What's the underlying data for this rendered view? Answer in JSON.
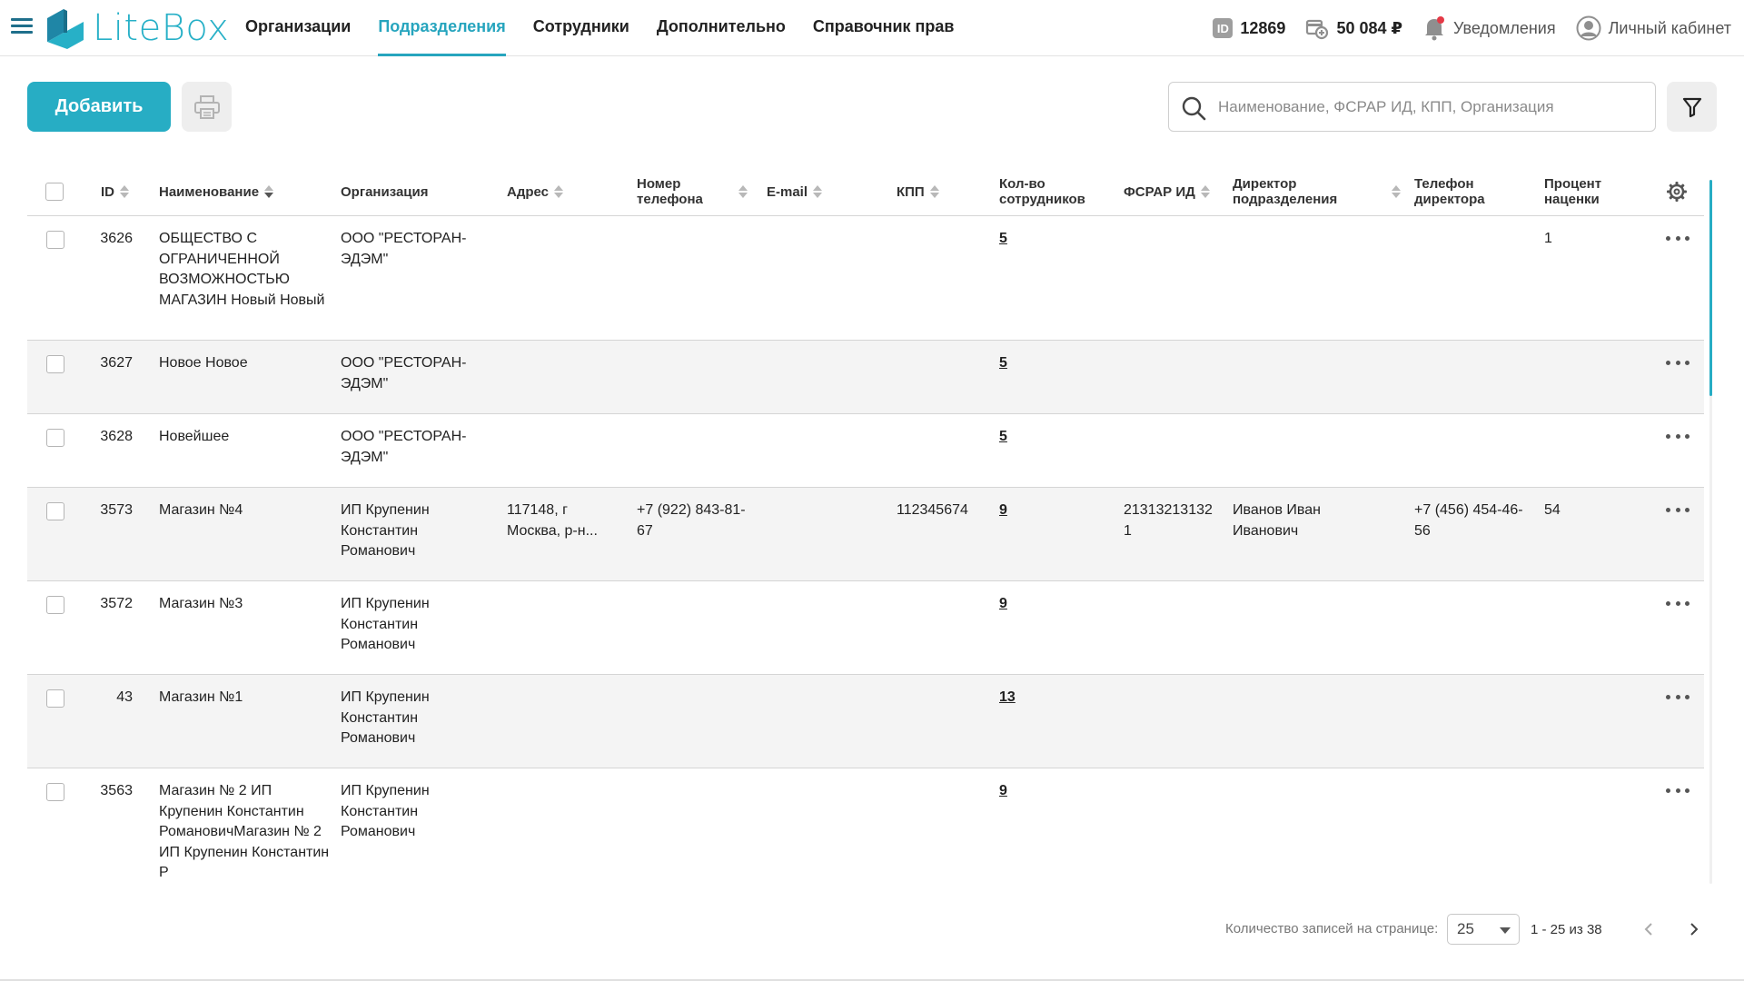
{
  "header": {
    "logo_text": "LiteBox",
    "nav": [
      {
        "label": "Организации",
        "active": false
      },
      {
        "label": "Подразделения",
        "active": true
      },
      {
        "label": "Сотрудники",
        "active": false
      },
      {
        "label": "Дополнительно",
        "active": false
      },
      {
        "label": "Справочник прав",
        "active": false
      }
    ],
    "id_badge": "ID",
    "account_id": "12869",
    "balance": "50 084 ₽",
    "notifications_label": "Уведомления",
    "cabinet_label": "Личный кабинет"
  },
  "toolbar": {
    "add_label": "Добавить",
    "search_placeholder": "Наименование, ФСРАР ИД, КПП, Организация"
  },
  "table": {
    "columns": {
      "id": "ID",
      "name": "Наименование",
      "org": "Организация",
      "address": "Адрес",
      "phone": "Номер телефона",
      "email": "E-mail",
      "kpp": "КПП",
      "employees": "Кол-во сотрудников",
      "fsrar": "ФСРАР ИД",
      "director": "Директор подразделения",
      "director_phone": "Телефон директора",
      "markup": "Процент наценки"
    },
    "rows": [
      {
        "id": "3626",
        "name": "ОБЩЕСТВО С ОГРАНИЧЕННОЙ ВОЗМОЖНОСТЬЮ МАГАЗИН Новый Новый",
        "org": "ООО \"РЕСТОРАН-ЭДЭМ\"",
        "address": "",
        "phone": "",
        "email": "",
        "kpp": "",
        "employees": "5",
        "fsrar": "",
        "director": "",
        "director_phone": "",
        "markup": "1"
      },
      {
        "id": "3627",
        "name": "Новое Новое",
        "org": "ООО \"РЕСТОРАН-ЭДЭМ\"",
        "address": "",
        "phone": "",
        "email": "",
        "kpp": "",
        "employees": "5",
        "fsrar": "",
        "director": "",
        "director_phone": "",
        "markup": ""
      },
      {
        "id": "3628",
        "name": "Новейшее",
        "org": "ООО \"РЕСТОРАН-ЭДЭМ\"",
        "address": "",
        "phone": "",
        "email": "",
        "kpp": "",
        "employees": "5",
        "fsrar": "",
        "director": "",
        "director_phone": "",
        "markup": ""
      },
      {
        "id": "3573",
        "name": "Магазин №4",
        "org": "ИП Крупенин Константин Романович",
        "address": "117148, г Москва, р-н...",
        "phone": "+7 (922) 843-81-67",
        "email": "",
        "kpp": "112345674",
        "employees": "9",
        "fsrar": "213132131321",
        "director": "Иванов Иван Иванович",
        "director_phone": "+7 (456) 454-46-56",
        "markup": "54"
      },
      {
        "id": "3572",
        "name": "Магазин №3",
        "org": "ИП Крупенин Константин Романович",
        "address": "",
        "phone": "",
        "email": "",
        "kpp": "",
        "employees": "9",
        "fsrar": "",
        "director": "",
        "director_phone": "",
        "markup": ""
      },
      {
        "id": "43",
        "name": "Магазин №1",
        "org": "ИП Крупенин Константин Романович",
        "address": "",
        "phone": "",
        "email": "",
        "kpp": "",
        "employees": "13",
        "fsrar": "",
        "director": "",
        "director_phone": "",
        "markup": ""
      },
      {
        "id": "3563",
        "name": "Магазин № 2 ИП Крупенин Константин РомановичМагазин № 2 ИП Крупенин Константин Р",
        "org": "ИП Крупенин Константин Романович",
        "address": "",
        "phone": "",
        "email": "",
        "kpp": "",
        "employees": "9",
        "fsrar": "",
        "director": "",
        "director_phone": "",
        "markup": ""
      }
    ]
  },
  "pagination": {
    "per_page_label": "Количество записей на странице:",
    "per_page_value": "25",
    "range": "1 - 25 из 38"
  },
  "colors": {
    "accent": "#27adc4",
    "row_alt": "#f4f4f4",
    "notification_dot": "#e53946"
  }
}
